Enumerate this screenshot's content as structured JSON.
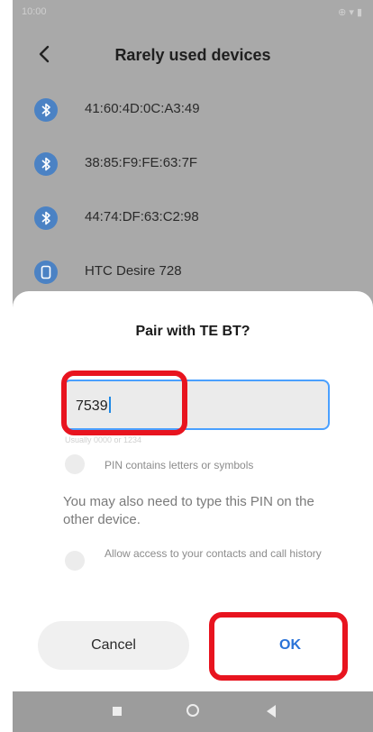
{
  "status_bar": {
    "time": "10:00",
    "icons": "⊕ ▾ ▮"
  },
  "header": {
    "title": "Rarely used devices"
  },
  "devices": [
    {
      "name": "41:60:4D:0C:A3:49",
      "icon": "bluetooth-icon"
    },
    {
      "name": "38:85:F9:FE:63:7F",
      "icon": "bluetooth-icon"
    },
    {
      "name": "44:74:DF:63:C2:98",
      "icon": "bluetooth-icon"
    },
    {
      "name": "HTC Desire 728",
      "icon": "phone-icon"
    }
  ],
  "dialog": {
    "title": "Pair with TE BT?",
    "pin_value": "7539",
    "pin_hint_peek": "Usually 0000 or 1234",
    "pin_letters_label": "PIN contains letters or symbols",
    "note": "You may also need to type this PIN on the other device.",
    "contacts_label": "Allow access to your contacts and call history",
    "cancel_label": "Cancel",
    "ok_label": "OK"
  },
  "colors": {
    "accent": "#2a73d8",
    "highlight": "#e8141f",
    "bluetooth": "#4b82c4"
  }
}
